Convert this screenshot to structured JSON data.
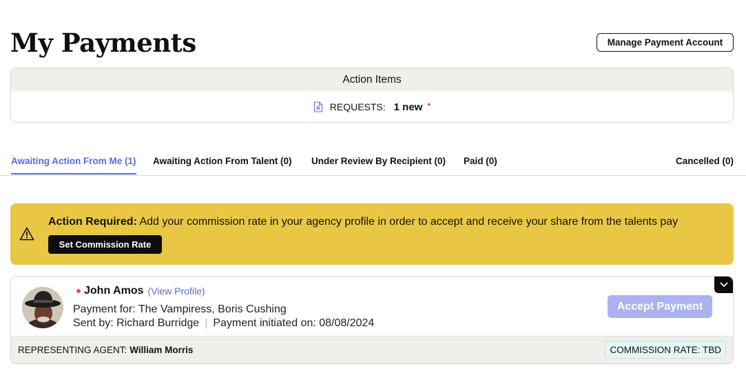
{
  "page": {
    "title": "My Payments",
    "manage_button": "Manage Payment Account"
  },
  "action_items": {
    "heading": "Action Items",
    "requests_label": "REQUESTS:",
    "requests_count": "1 new",
    "new_indicator": "•"
  },
  "tabs": [
    {
      "label": "Awaiting Action From Me (1)",
      "active": true
    },
    {
      "label": "Awaiting Action From Talent (0)",
      "active": false
    },
    {
      "label": "Under Review By Recipient (0)",
      "active": false
    },
    {
      "label": "Paid (0)",
      "active": false
    },
    {
      "label": "Cancelled (0)",
      "active": false
    }
  ],
  "alert": {
    "title": "Action Required:",
    "message": " Add your commission rate in your agency profile in order to accept and receive your share from the talents pay",
    "button": "Set Commission Rate",
    "icon": "warning-icon",
    "color": "#e9c744"
  },
  "payment": {
    "talent_name": "John Amos",
    "view_profile": "(View Profile)",
    "payment_for": "Payment for: The Vampiress, Boris Cushing",
    "sent_by": "Sent by: Richard Burridge",
    "separator": "|",
    "initiated": "Payment initiated on: 08/08/2024",
    "accept_button": "Accept Payment",
    "agent_label": "REPRESENTING AGENT:",
    "agent_name": "William Morris",
    "commission": "COMMISSION RATE: TBD"
  },
  "colors": {
    "accent": "#5b6bdc",
    "accept_disabled": "#aab2f0",
    "new_dot": "#e5533d"
  }
}
